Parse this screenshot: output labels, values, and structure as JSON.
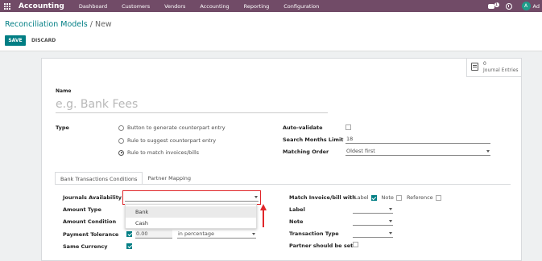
{
  "topbar": {
    "app_name": "Accounting",
    "menu": [
      "Dashboard",
      "Customers",
      "Vendors",
      "Accounting",
      "Reporting",
      "Configuration"
    ],
    "chat_badge": "1",
    "avatar_letter": "A",
    "user": "Ad",
    "bg_color": "#714b67"
  },
  "breadcrumb": {
    "parent": "Reconciliation Models",
    "separator": " / ",
    "current": "New"
  },
  "buttons": {
    "save": "SAVE",
    "discard": "DISCARD"
  },
  "smart_button": {
    "count": "0",
    "label": "Journal Entries",
    "icon": "book-icon"
  },
  "form": {
    "name_label": "Name",
    "name_placeholder": "e.g. Bank Fees",
    "type_label": "Type",
    "type_options": [
      {
        "label": "Button to generate counterpart entry",
        "checked": false
      },
      {
        "label": "Rule to suggest counterpart entry",
        "checked": false
      },
      {
        "label": "Rule to match invoices/bills",
        "checked": true
      }
    ],
    "auto_validate_label": "Auto-validate",
    "auto_validate": false,
    "search_months_label": "Search Months Limit",
    "search_months_value": "18",
    "matching_order_label": "Matching Order",
    "matching_order_value": "Oldest first"
  },
  "tabs": [
    {
      "label": "Bank Transactions Conditions",
      "active": true
    },
    {
      "label": "Partner Mapping",
      "active": false
    }
  ],
  "conditions": {
    "journals_label": "Journals Availability",
    "journals_value": "",
    "journal_options": [
      "Bank",
      "Cash"
    ],
    "amount_type_label": "Amount Type",
    "amount_condition_label": "Amount Condition",
    "payment_tolerance_label": "Payment Tolerance",
    "payment_tolerance_checked": true,
    "payment_tolerance_value": "0.00",
    "payment_tolerance_unit": "in percentage",
    "same_currency_label": "Same Currency",
    "same_currency_checked": true,
    "match_label": "Match Invoice/bill with",
    "match_options": [
      {
        "label": "Label",
        "checked": true
      },
      {
        "label": "Note",
        "checked": false
      },
      {
        "label": "Reference",
        "checked": false
      }
    ],
    "label_label": "Label",
    "note_label": "Note",
    "transaction_type_label": "Transaction Type",
    "partner_set_label": "Partner should be set",
    "partner_set_checked": false
  },
  "accent_color": "#017e84",
  "annotation_color": "#e0262a"
}
